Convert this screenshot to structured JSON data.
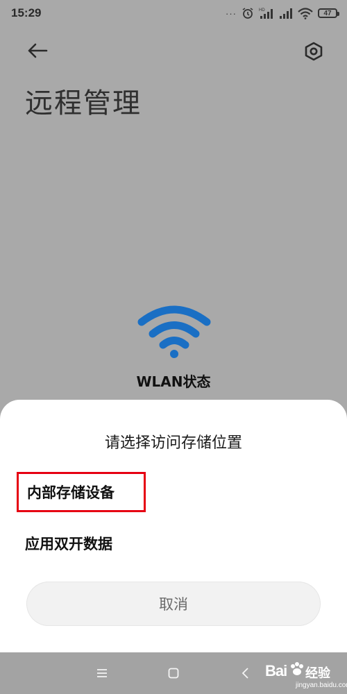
{
  "status_bar": {
    "time": "15:29",
    "notification_dots": "···",
    "battery_level": "47",
    "icons": [
      "more-dots-icon",
      "alarm-icon",
      "hd-signal-icon",
      "signal-icon",
      "wifi-icon",
      "battery-icon"
    ]
  },
  "header": {
    "back_icon": "arrow-left-icon",
    "settings_icon": "gear-hex-icon",
    "title": "远程管理"
  },
  "wifi_status": {
    "icon": "wifi-icon",
    "label": "WLAN状态",
    "color": "#1a6fc4"
  },
  "sheet": {
    "title": "请选择访问存储位置",
    "options": [
      {
        "label": "内部存储设备",
        "highlighted": true
      },
      {
        "label": "应用双开数据",
        "highlighted": false
      }
    ],
    "cancel_label": "取消",
    "highlight_color": "#e60012"
  },
  "nav_bar": {
    "icons": [
      "menu-icon",
      "home-icon",
      "back-chevron-icon"
    ]
  },
  "watermark": {
    "logo": "Bai",
    "text": "经验",
    "url": "jingyan.baidu.com"
  }
}
